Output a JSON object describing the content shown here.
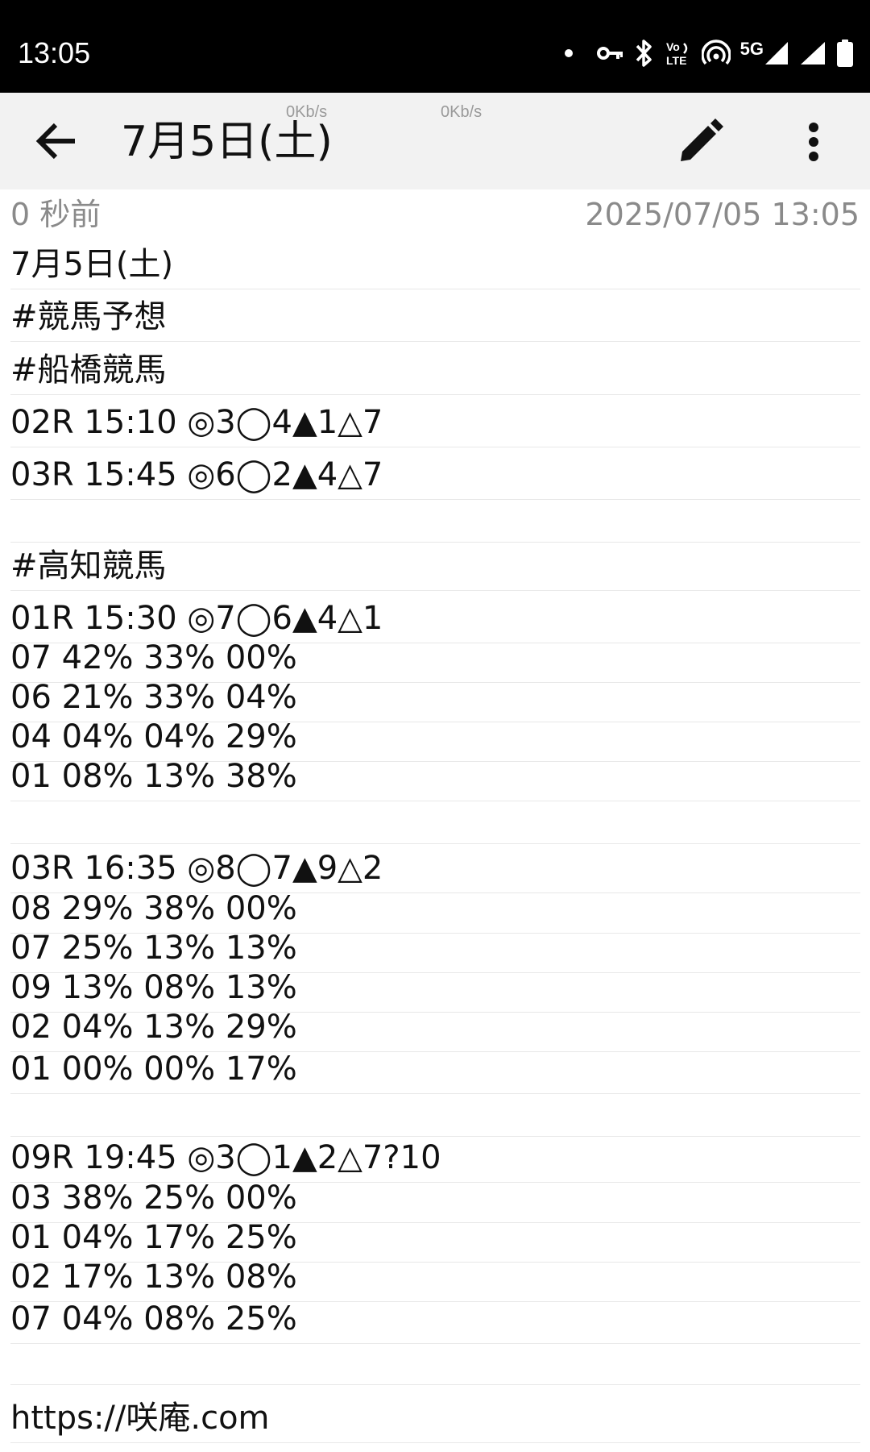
{
  "status_bar": {
    "time": "13:05",
    "icons": [
      "notification-dot-icon",
      "vpn-key-icon",
      "bluetooth-icon",
      "volte-icon",
      "hotspot-icon",
      "5g-signal-icon",
      "signal-icon",
      "battery-icon"
    ],
    "network_label": "5G",
    "volte_label_top": "Vo",
    "volte_label_bottom": "LTE"
  },
  "app_bar": {
    "title": "7月5日(土)",
    "net_speed_1": "0Kb/s",
    "net_speed_2": "0Kb/s",
    "back_icon": "arrow-back-icon",
    "edit_icon": "pencil-icon",
    "more_icon": "more-vert-icon"
  },
  "meta": {
    "relative_time": "0 秒前",
    "datetime": "2025/07/05 13:05"
  },
  "note": {
    "lines": [
      "7月5日(土)",
      "#競馬予想",
      "#船橋競馬",
      "02R 15:10 ◎3◯4▲1△7",
      "03R 15:45 ◎6◯2▲4△7",
      "",
      "#高知競馬",
      "01R 15:30 ◎7◯6▲4△1",
      "07 42% 33% 00%",
      "06 21% 33% 04%",
      "04 04% 04% 29%",
      "01 08% 13% 38%",
      "",
      "03R 16:35 ◎8◯7▲9△2",
      "08 29% 38% 00%",
      "07 25% 13% 13%",
      "09 13% 08% 13%",
      "02 04% 13% 29%",
      "01 00% 00% 17%",
      "",
      "09R 19:45 ◎3◯1▲2△7?10",
      "03 38% 25% 00%",
      "01 04% 17% 25%",
      "02 17% 13% 08%",
      "07 04% 08% 25%",
      "",
      "https://咲庵.com"
    ]
  },
  "colors": {
    "status_bar_bg": "#000000",
    "app_bar_bg": "#f2f2f2",
    "meta_text": "#8a8a8a",
    "rule_line": "#e8e8e8"
  }
}
